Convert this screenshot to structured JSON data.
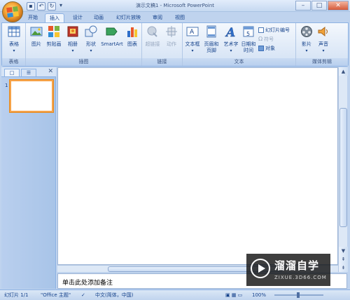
{
  "window": {
    "title": "演示文稿1 - Microsoft PowerPoint",
    "min": "–",
    "max": "□",
    "close": "✕"
  },
  "qat": {
    "save": "▪",
    "undo": "↶",
    "redo": "↻",
    "more": "▾"
  },
  "tabs": [
    "开始",
    "插入",
    "设计",
    "动画",
    "幻灯片放映",
    "审阅",
    "视图"
  ],
  "active_tab": "插入",
  "ribbon": {
    "groups": {
      "tables": "表格",
      "illustrations": "插图",
      "links": "链接",
      "text": "文本",
      "media": "媒体剪辑"
    },
    "buttons": {
      "table": "表格",
      "picture": "图片",
      "clipart": "剪贴画",
      "album": "相册",
      "shapes": "形状",
      "smartart": "SmartArt",
      "chart": "图表",
      "hyperlink": "超链接",
      "action": "动作",
      "textbox": "文本框",
      "header_footer_1": "页眉和",
      "header_footer_2": "页脚",
      "wordart": "艺术字",
      "datetime_1": "日期和",
      "datetime_2": "时间",
      "slide_number": "幻灯片编号",
      "symbol": "符号",
      "object": "对象",
      "movie": "影片",
      "sound": "声音"
    }
  },
  "left_pane": {
    "tab1": "□",
    "tab2": "☰",
    "close": "✕",
    "slide_number": "1"
  },
  "notes_placeholder": "单击此处添加备注",
  "status": {
    "slide": "幻灯片 1/1",
    "theme": "\"Office 主题\"",
    "language": "中文(简体，中国)",
    "zoom": "100%"
  },
  "watermark": {
    "text": "溜溜自学",
    "sub": "ZIXUE.3D66.COM"
  }
}
